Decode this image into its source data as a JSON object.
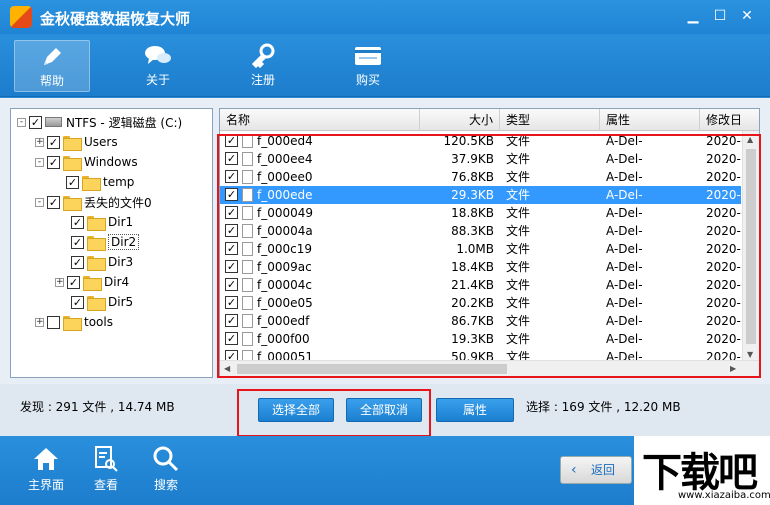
{
  "window": {
    "title": "金秋硬盘数据恢复大师",
    "minimize_glyph": "▁",
    "maximize_glyph": "☐",
    "close_glyph": "✕"
  },
  "toolbar": {
    "items": [
      {
        "label": "帮助",
        "icon": "pencil-icon",
        "active": true
      },
      {
        "label": "关于",
        "icon": "chat-bubbles-icon",
        "active": false
      },
      {
        "label": "注册",
        "icon": "key-icon",
        "active": false
      },
      {
        "label": "购买",
        "icon": "cart-icon",
        "active": false
      }
    ]
  },
  "tree": {
    "root_label": "NTFS - 逻辑磁盘 (C:)",
    "items": [
      {
        "label": "Users",
        "expander": "+",
        "checked": "✓"
      },
      {
        "label": "Windows",
        "expander": "-",
        "checked": "✓"
      },
      {
        "label": "temp",
        "expander": "",
        "checked": "✓"
      },
      {
        "label": "丢失的文件0",
        "expander": "-",
        "checked": "✓"
      },
      {
        "label": "Dir1",
        "expander": "",
        "checked": "✓"
      },
      {
        "label": "Dir2",
        "expander": "",
        "checked": "✓"
      },
      {
        "label": "Dir3",
        "expander": "",
        "checked": "✓"
      },
      {
        "label": "Dir4",
        "expander": "+",
        "checked": "✓"
      },
      {
        "label": "Dir5",
        "expander": "",
        "checked": "✓"
      },
      {
        "label": "tools",
        "expander": "+",
        "checked": ""
      }
    ],
    "root_expander": "-",
    "root_checked": "✓"
  },
  "filelist": {
    "columns": [
      "名称",
      "大小",
      "类型",
      "属性",
      "修改日"
    ],
    "rows": [
      {
        "name": "f_000ed4",
        "size": "120.5KB",
        "type": "文件",
        "attr": "A-Del-",
        "date": "2020-"
      },
      {
        "name": "f_000ee4",
        "size": "37.9KB",
        "type": "文件",
        "attr": "A-Del-",
        "date": "2020-"
      },
      {
        "name": "f_000ee0",
        "size": "76.8KB",
        "type": "文件",
        "attr": "A-Del-",
        "date": "2020-"
      },
      {
        "name": "f_000ede",
        "size": "29.3KB",
        "type": "文件",
        "attr": "A-Del-",
        "date": "2020-"
      },
      {
        "name": "f_000049",
        "size": "18.8KB",
        "type": "文件",
        "attr": "A-Del-",
        "date": "2020-"
      },
      {
        "name": "f_00004a",
        "size": "88.3KB",
        "type": "文件",
        "attr": "A-Del-",
        "date": "2020-"
      },
      {
        "name": "f_000c19",
        "size": "1.0MB",
        "type": "文件",
        "attr": "A-Del-",
        "date": "2020-"
      },
      {
        "name": "f_0009ac",
        "size": "18.4KB",
        "type": "文件",
        "attr": "A-Del-",
        "date": "2020-"
      },
      {
        "name": "f_00004c",
        "size": "21.4KB",
        "type": "文件",
        "attr": "A-Del-",
        "date": "2020-"
      },
      {
        "name": "f_000e05",
        "size": "20.2KB",
        "type": "文件",
        "attr": "A-Del-",
        "date": "2020-"
      },
      {
        "name": "f_000edf",
        "size": "86.7KB",
        "type": "文件",
        "attr": "A-Del-",
        "date": "2020-"
      },
      {
        "name": "f_000f00",
        "size": "19.3KB",
        "type": "文件",
        "attr": "A-Del-",
        "date": "2020-"
      },
      {
        "name": "f_000051",
        "size": "50.9KB",
        "type": "文件",
        "attr": "A-Del-",
        "date": "2020-"
      }
    ],
    "selected_row": 3,
    "check_glyph": "✓"
  },
  "actions": {
    "found_text": "发现 : 291 文件 , 14.74 MB",
    "select_all": "选择全部",
    "deselect_all": "全部取消",
    "properties": "属性",
    "selected_text": "选择 : 169 文件 , 12.20 MB"
  },
  "bottom_nav": {
    "items": [
      {
        "label": "主界面",
        "icon": "home-icon"
      },
      {
        "label": "查看",
        "icon": "document-search-icon"
      },
      {
        "label": "搜索",
        "icon": "magnifier-icon"
      }
    ],
    "back_label": "返回",
    "back_chevron": "‹"
  },
  "watermark": {
    "main": "下载吧",
    "url": "www.xiazaiba.com"
  },
  "colors": {
    "accent": "#1c7dcc",
    "selection": "#3399ff",
    "highlight_box": "#e8141b"
  }
}
